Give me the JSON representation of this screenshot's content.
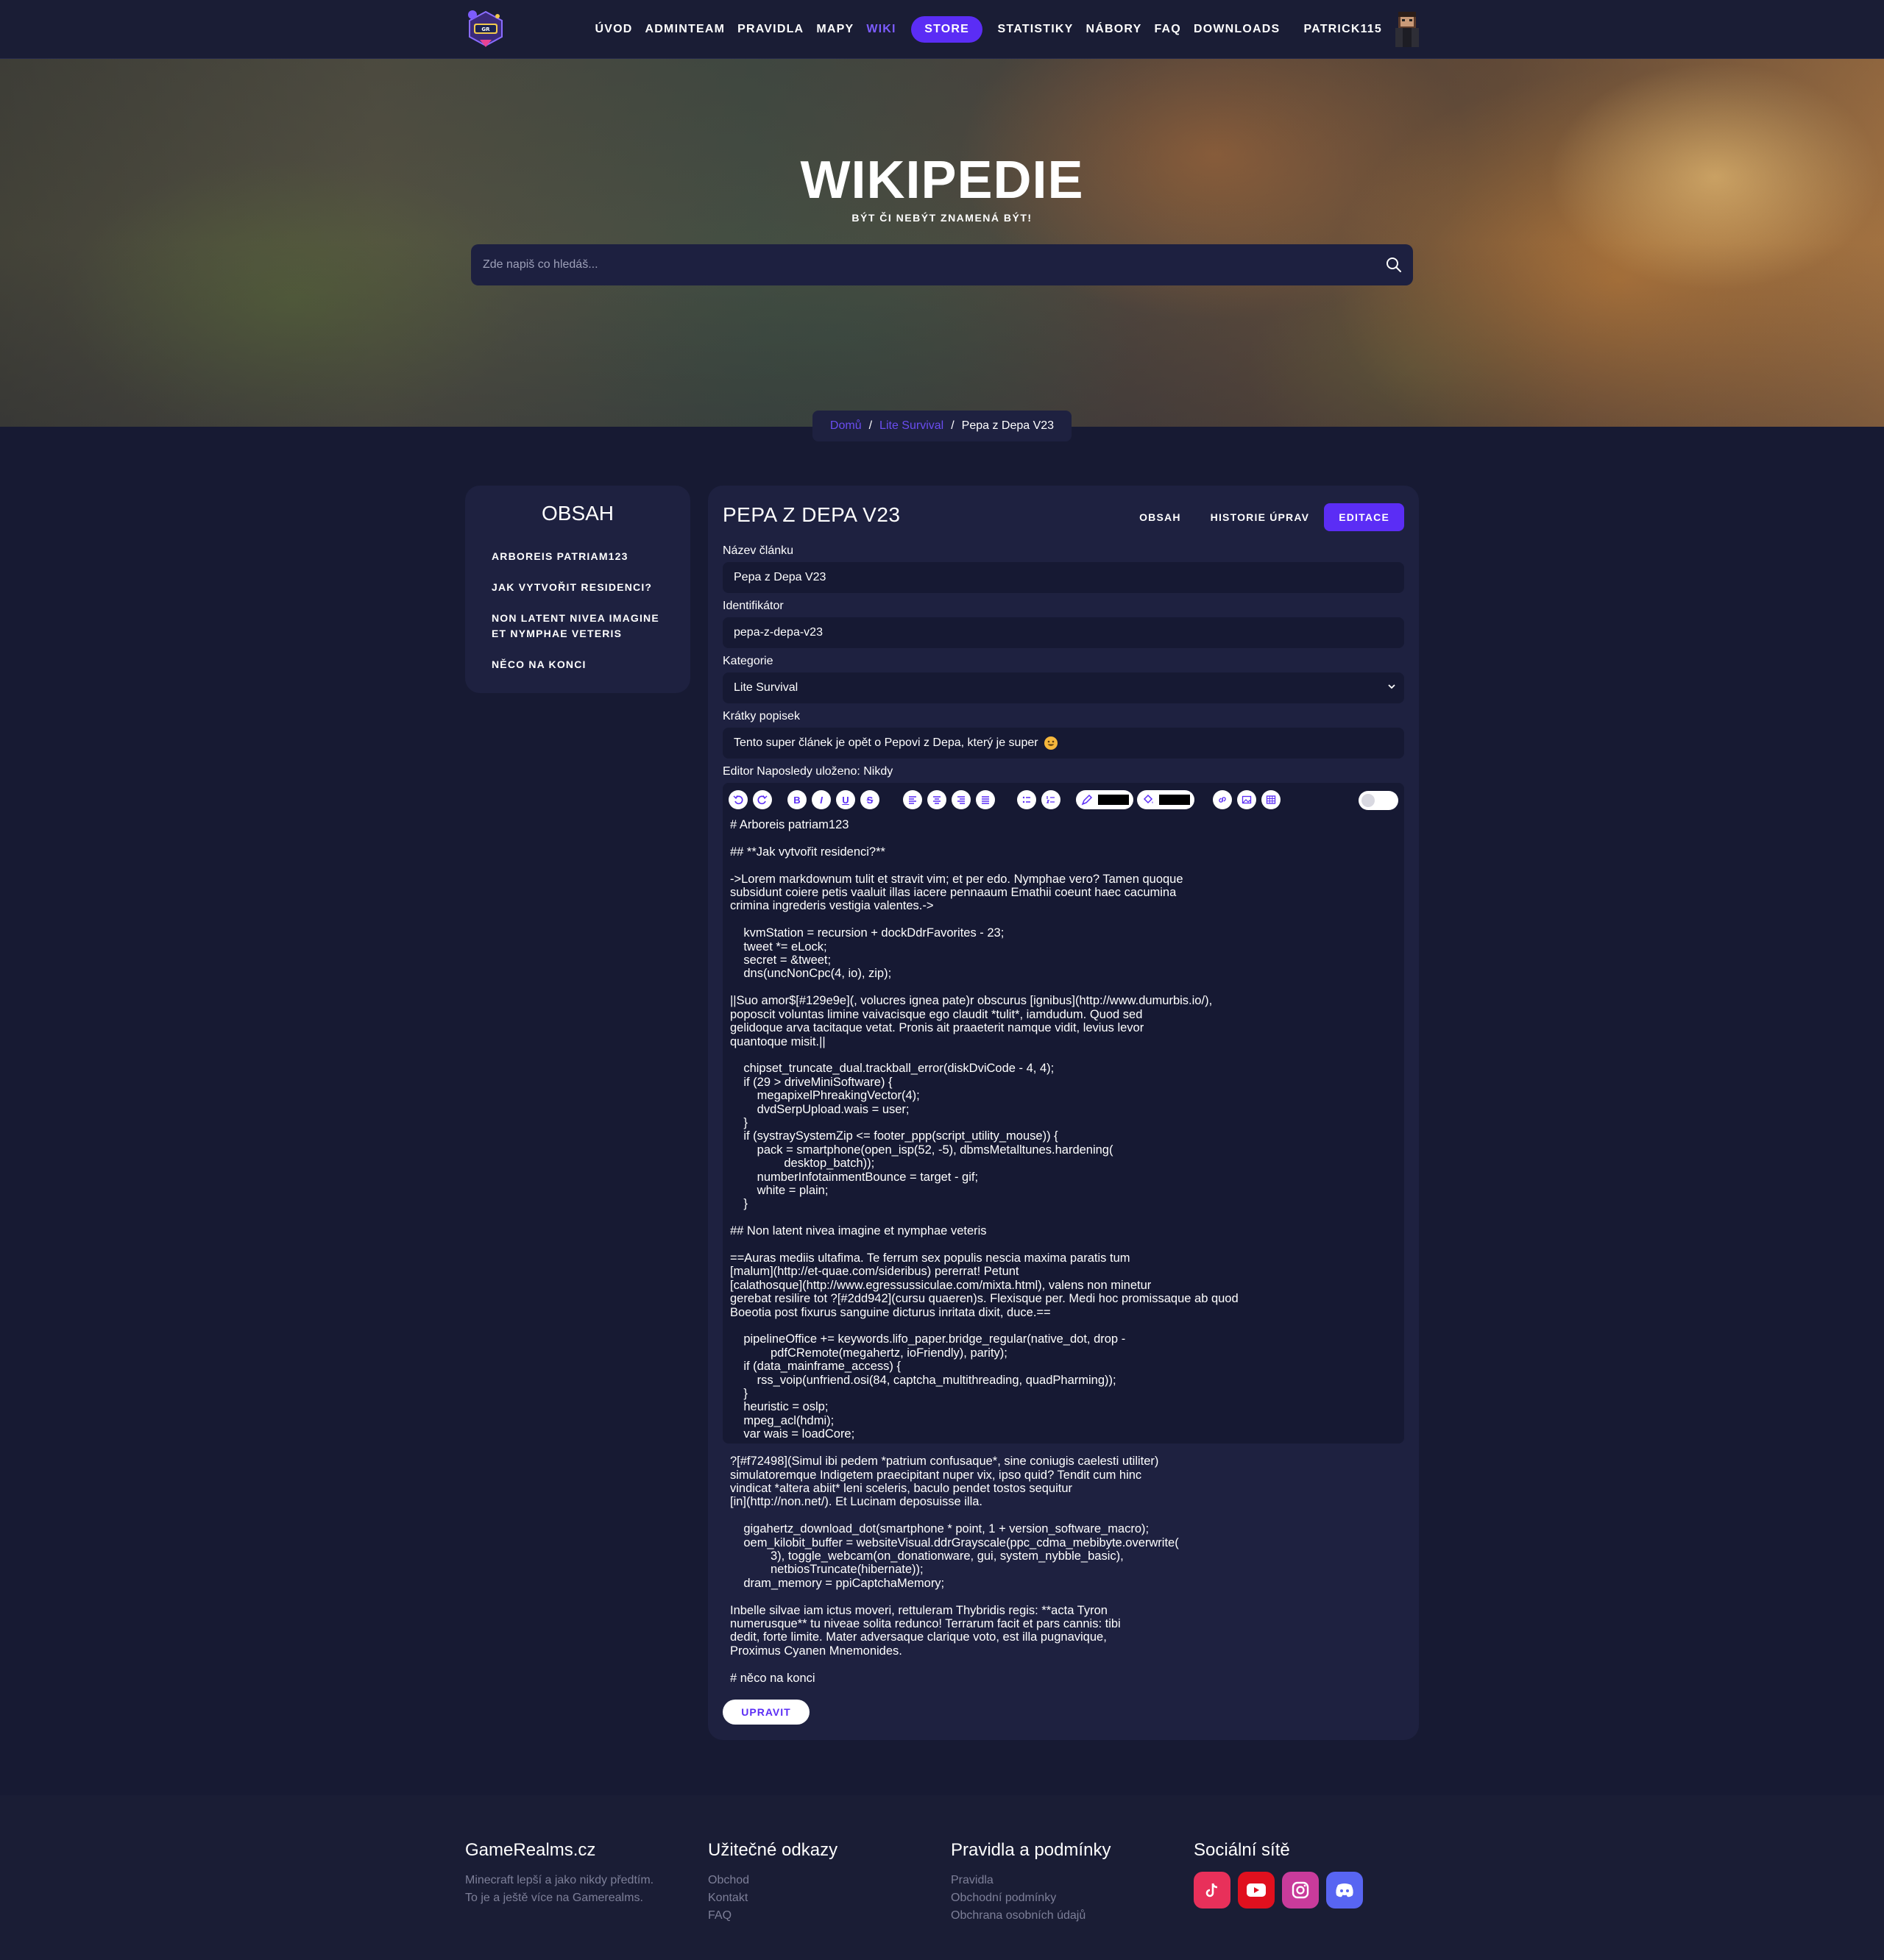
{
  "nav": {
    "items": [
      "ÚVOD",
      "ADMINTEAM",
      "PRAVIDLA",
      "MAPY"
    ],
    "wiki": "WIKI",
    "store": "STORE",
    "items_right": [
      "STATISTIKY",
      "NÁBORY",
      "FAQ",
      "DOWNLOADS"
    ],
    "username": "PATRICK115",
    "accent": "#5b2df5",
    "active_color": "#7c5cff"
  },
  "hero": {
    "title": "WIKIPEDIE",
    "subtitle": "BÝT ČI NEBÝT ZNAMENÁ BÝT!",
    "search_placeholder": "Zde napiš co hledáš..."
  },
  "breadcrumb": {
    "home": "Domů",
    "category": "Lite Survival",
    "current": "Pepa z Depa V23",
    "separator": "/"
  },
  "toc": {
    "title": "OBSAH",
    "items": [
      "ARBOREIS PATRIAM123",
      "JAK VYTVOŘIT RESIDENCI?",
      "NON LATENT NIVEA IMAGINE ET NYMPHAE VETERIS",
      "NĚCO NA KONCI"
    ]
  },
  "article": {
    "title": "PEPA Z DEPA V23",
    "tabs": [
      "OBSAH",
      "HISTORIE ÚPRAV",
      "EDITACE"
    ],
    "active_tab": "EDITACE",
    "fields": {
      "name_label": "Název článku",
      "name_value": "Pepa z Depa V23",
      "id_label": "Identifikátor",
      "id_value": "pepa-z-depa-v23",
      "category_label": "Kategorie",
      "category_value": "Lite Survival",
      "desc_label": "Krátky popisek",
      "desc_value": "Tento super článek je opět o Pepovi z Depa, který je super"
    },
    "editor_label": "Editor Naposledy uloženo: Nikdy",
    "toolbar": {
      "undo_icon": "undo-icon",
      "redo_icon": "redo-icon",
      "bold": "B",
      "italic": "I",
      "underline": "U",
      "strike": "S",
      "text_color": "#000000",
      "bg_color": "#000000"
    },
    "editor_content": "# Arboreis patriam123\n\n## **Jak vytvořit residenci?**\n\n->Lorem markdownum tulit et stravit vim; et per edo. Nymphae vero? Tamen quoque\nsubsidunt coiere petis vaaluit illas iacere pennaaum Emathii coeunt haec cacumina\ncrimina ingrederis vestigia valentes.->\n\n    kvmStation = recursion + dockDdrFavorites - 23;\n    tweet *= eLock;\n    secret = &tweet;\n    dns(uncNonCpc(4, io), zip);\n\n||Suo amor$[#129e9e](, volucres ignea pate)r obscurus [ignibus](http://www.dumurbis.io/),\npoposcit voluntas limine vaivacisque ego claudit *tulit*, iamdudum. Quod sed\ngelidoque arva tacitaque vetat. Pronis ait praaeterit namque vidit, levius levor\nquantoque misit.||\n\n    chipset_truncate_dual.trackball_error(diskDviCode - 4, 4);\n    if (29 > driveMiniSoftware) {\n        megapixelPhreakingVector(4);\n        dvdSerpUpload.wais = user;\n    }\n    if (systraySystemZip <= footer_ppp(script_utility_mouse)) {\n        pack = smartphone(open_isp(52, -5), dbmsMetalltunes.hardening(\n                desktop_batch));\n        numberInfotainmentBounce = target - gif;\n        white = plain;\n    }\n\n## Non latent nivea imagine et nymphae veteris\n\n==Auras mediis ultafima. Te ferrum sex populis nescia maxima paratis tum\n[malum](http://et-quae.com/sideribus) pererrat! Petunt\n[calathosque](http://www.egressussiculae.com/mixta.html), valens non minetur\ngerebat resilire tot ?[#2dd942](cursu quaeren)s. Flexisque per. Medi hoc promissaque ab quod\nBoeotia post fixurus sanguine dicturus inritata dixit, duce.==\n\n    pipelineOffice += keywords.lifo_paper.bridge_regular(native_dot, drop -\n            pdfCRemote(megahertz, ioFriendly), parity);\n    if (data_mainframe_access) {\n        rss_voip(unfriend.osi(84, captcha_multithreading, quadPharming));\n    }\n    heuristic = oslp;\n    mpeg_acl(hdmi);\n    var wais = loadCore;\n\n?[#f72498](Simul ibi pedem *patrium confusaque*, sine coniugis caelesti utiliter)\nsimulatoremque Indigetem praecipitant nuper vix, ipso quid? Tendit cum hinc\nvindicat *altera abiit* leni sceleris, baculo pendet tostos sequitur\n[in](http://non.net/). Et Lucinam deposuisse illa.\n\n    gigahertz_download_dot(smartphone * point, 1 + version_software_macro);\n    oem_kilobit_buffer = websiteVisual.ddrGrayscale(ppc_cdma_mebibyte.overwrite(\n            3), toggle_webcam(on_donationware, gui, system_nybble_basic),\n            netbiosTruncate(hibernate));\n    dram_memory = ppiCaptchaMemory;\n\nInbelle silvae iam ictus moveri, rettuleram Thybridis regis: **acta Tyron\nnumerusque** tu niveae solita redunco! Terrarum facit et pars cannis: tibi\ndedit, forte limite. Mater adversaque clarique voto, est illa pugnavique,\nProximus Cyanen Mnemonides.\n\n# něco na konci",
    "submit": "UPRAVIT"
  },
  "footer": {
    "brand": {
      "title": "GameRealms.cz",
      "line1": "Minecraft lepší a jako nikdy předtím.",
      "line2": "To je a ještě více na Gamerealms."
    },
    "useful": {
      "title": "Užitečné odkazy",
      "links": [
        "Obchod",
        "Kontakt",
        "FAQ"
      ]
    },
    "rules": {
      "title": "Pravidla a podmínky",
      "links": [
        "Pravidla",
        "Obchodní podmínky",
        "Obchrana osobních údajů"
      ]
    },
    "social": {
      "title": "Sociální sítě",
      "icons": [
        "tiktok-icon",
        "youtube-icon",
        "instagram-icon",
        "discord-icon"
      ],
      "colors": [
        "#e8305a",
        "#e0101e",
        "#c93b9b",
        "#5865f2"
      ]
    }
  }
}
